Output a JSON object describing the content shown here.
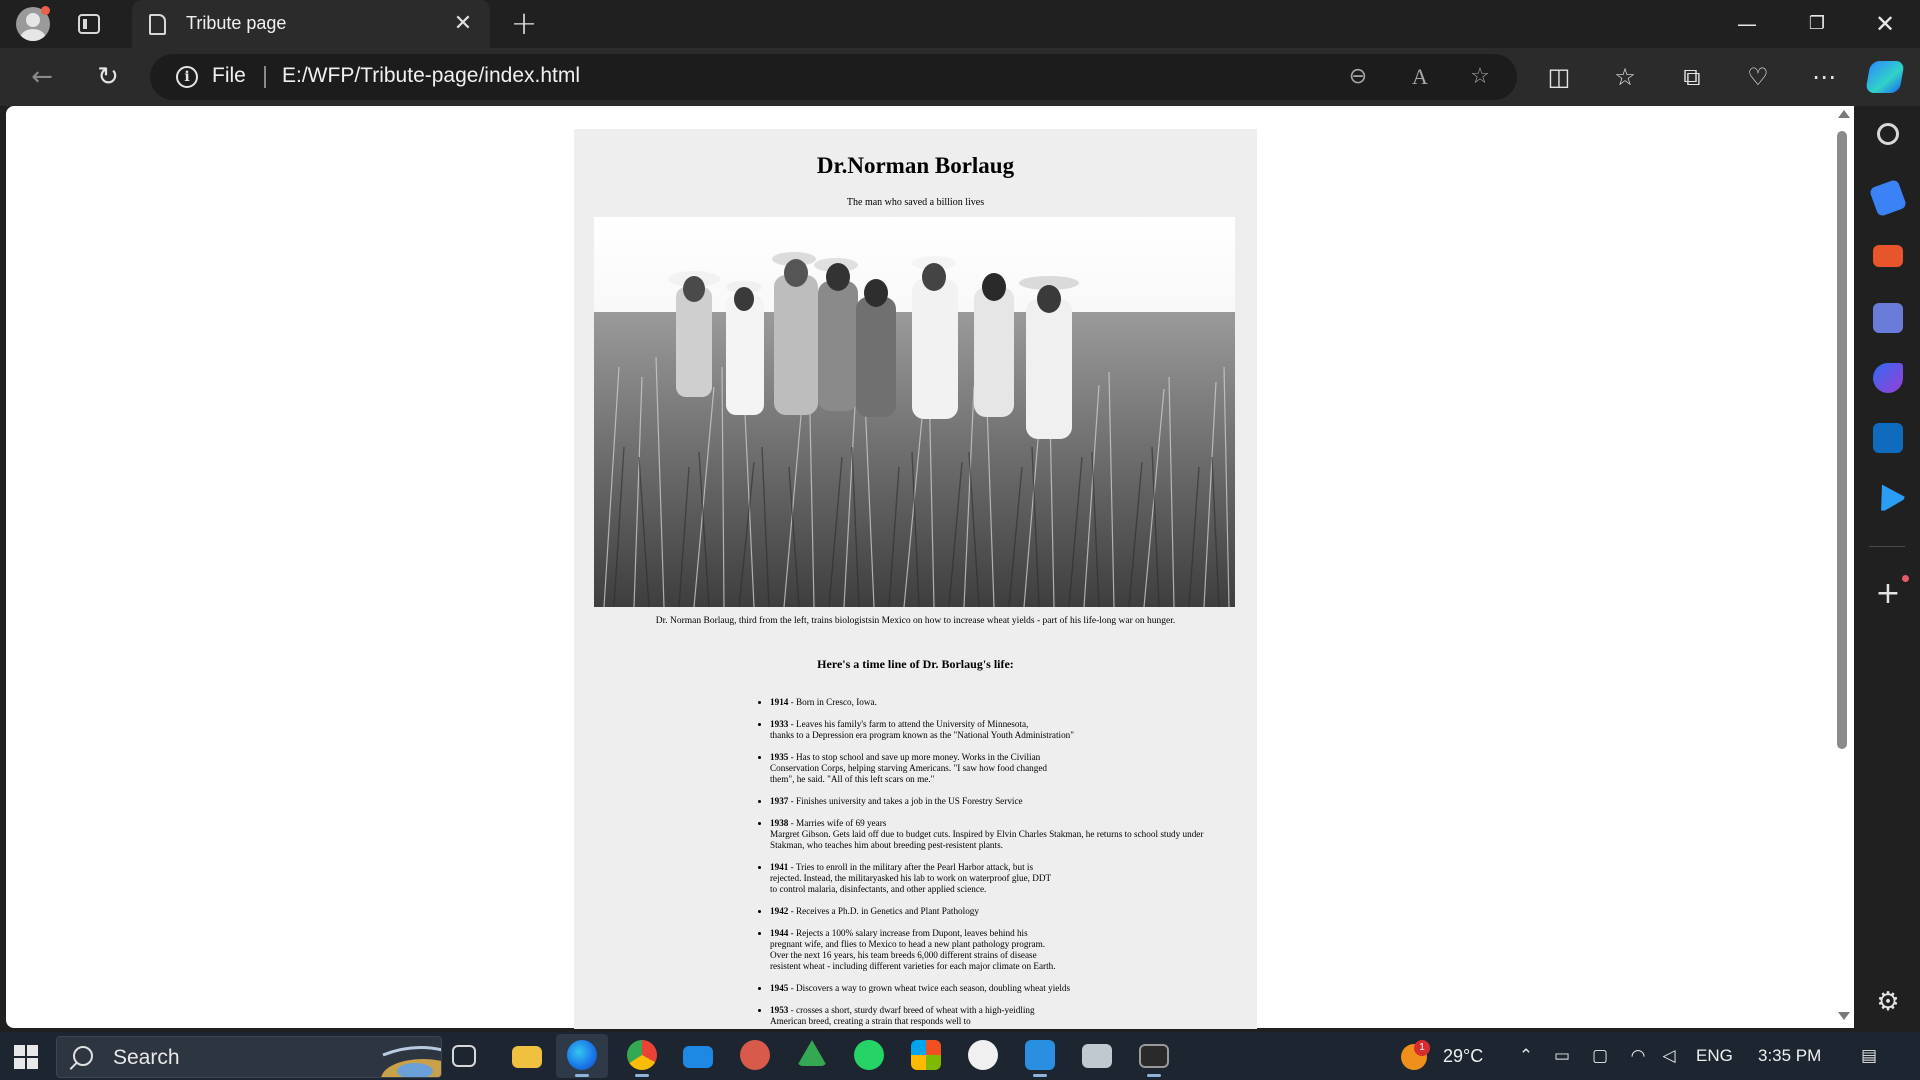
{
  "browser": {
    "tab_title": "Tribute page",
    "address_scheme": "File",
    "address_url": "E:/WFP/Tribute-page/index.html"
  },
  "page": {
    "title": "Dr.Norman Borlaug",
    "subtitle": "The man who saved a billion lives",
    "caption": "Dr. Norman Borlaug, third from the left, trains biologistsin Mexico on how to increase wheat yields - part of his life-long war on hunger.",
    "timeline_heading": "Here's a time line of Dr. Borlaug's life:",
    "timeline": [
      {
        "year": "1914",
        "lines": [
          "- Born in Cresco, Iowa."
        ]
      },
      {
        "year": "1933",
        "lines": [
          "- Leaves his family's farm to attend the University of Minnesota,",
          "thanks to a Depression era program known as the \"National Youth Administration\""
        ]
      },
      {
        "year": "1935",
        "lines": [
          "- Has to stop school and save up more money. Works in the Civilian",
          "Conservation Corps, helping starving Americans. \"I saw how food changed",
          "them\", he said. \"All of this left scars on me.\""
        ]
      },
      {
        "year": "1937",
        "lines": [
          "- Finishes university and takes a job in the US Forestry Service"
        ]
      },
      {
        "year": "1938",
        "lines": [
          "- Marries wife of 69 years",
          "Margret Gibson. Gets laid off due to budget cuts. Inspired by Elvin Charles Stakman, he returns to school study under",
          "Stakman, who teaches him about breeding pest-resistent plants."
        ]
      },
      {
        "year": "1941",
        "lines": [
          "- Tries to enroll in the military after the Pearl Harbor attack, but is",
          "rejected. Instead, the militaryasked his lab to work on waterproof glue, DDT",
          "to control malaria, disinfectants, and other applied science."
        ]
      },
      {
        "year": "1942",
        "lines": [
          "- Receives a Ph.D. in Genetics and Plant Pathology"
        ]
      },
      {
        "year": "1944",
        "lines": [
          "- Rejects a 100% salary increase from Dupont, leaves behind his",
          "pregnant wife, and flies to Mexico to head a new plant pathology program.",
          "Over the next 16 years, his team breeds 6,000 different strains of disease",
          "resistent wheat - including different varieties for each major climate on Earth."
        ]
      },
      {
        "year": "1945",
        "lines": [
          "- Discovers a way to grown wheat twice each season, doubling wheat yields"
        ]
      },
      {
        "year": "1953",
        "lines": [
          "- crosses a short, sturdy dwarf breed of wheat with a high-yeidling",
          "American breed, creating a strain that responds well to"
        ]
      }
    ]
  },
  "taskbar": {
    "search_label": "Search",
    "weather_temp": "29°C",
    "weather_badge": "1",
    "language": "ENG",
    "time": "3:35 PM"
  },
  "icons": {
    "toolbar": [
      "zoom-out-icon",
      "read-aloud-icon",
      "favorite-star-icon",
      "split-screen-icon",
      "favorites-icon",
      "collections-icon",
      "browser-essentials-icon",
      "more-icon",
      "copilot-icon"
    ],
    "sidebar": [
      "search-icon",
      "shopping-icon",
      "tools-icon",
      "games-icon",
      "bing-icon",
      "outlook-icon",
      "telegram-icon",
      "add-icon",
      "settings-icon"
    ]
  }
}
